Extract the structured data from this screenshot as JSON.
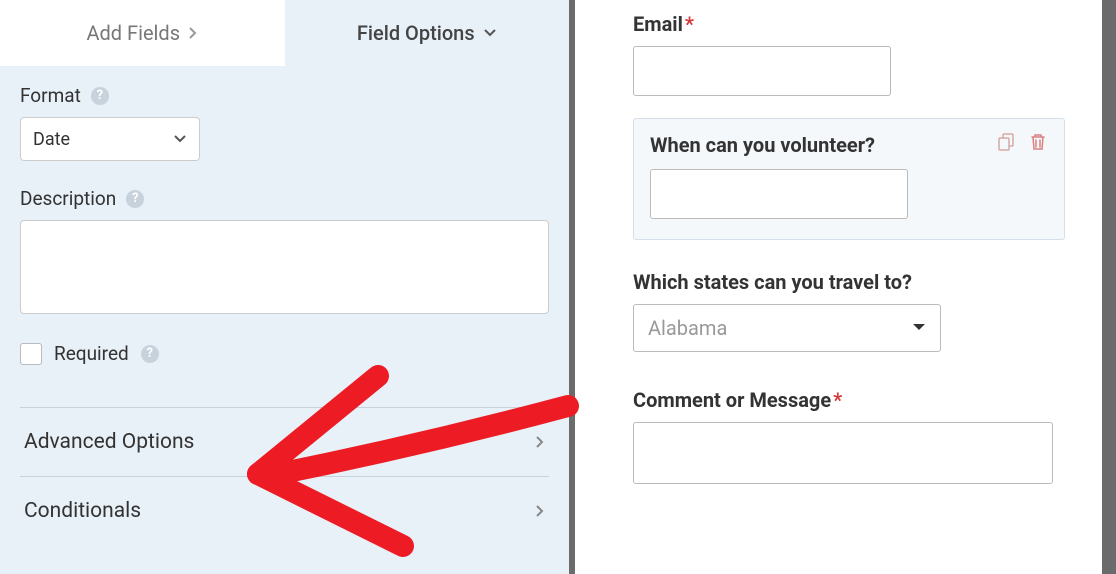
{
  "tabs": {
    "add_fields": "Add Fields",
    "field_options": "Field Options"
  },
  "left": {
    "format_label": "Format",
    "format_value": "Date",
    "description_label": "Description",
    "description_value": "",
    "required_label": "Required",
    "advanced_options": "Advanced Options",
    "conditionals": "Conditionals"
  },
  "form": {
    "email": {
      "label": "Email",
      "required": true,
      "value": ""
    },
    "volunteer": {
      "label": "When can you volunteer?",
      "value": ""
    },
    "states": {
      "label": "Which states can you travel to?",
      "selected": "Alabama"
    },
    "comment": {
      "label": "Comment or Message",
      "required": true,
      "value": ""
    }
  }
}
